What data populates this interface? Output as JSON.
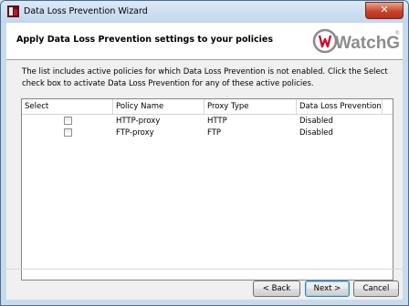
{
  "window": {
    "title": "Data Loss Prevention Wizard",
    "close_label": "✕"
  },
  "header": {
    "title": "Apply Data Loss Prevention settings to your policies",
    "logo_text": "WatchGuard",
    "logo_reg": "®"
  },
  "description": "The list includes active policies for which Data Loss Prevention is not enabled. Click the Select check box to activate Data Loss Prevention for any of these active policies.",
  "table": {
    "columns": [
      "Select",
      "Policy Name",
      "Proxy Type",
      "Data Loss Prevention"
    ],
    "rows": [
      {
        "selected": false,
        "policy": "HTTP-proxy",
        "type": "HTTP",
        "dlp": "Disabled"
      },
      {
        "selected": false,
        "policy": "FTP-proxy",
        "type": "FTP",
        "dlp": "Disabled"
      }
    ]
  },
  "buttons": {
    "back": "< Back",
    "next": "Next >",
    "cancel": "Cancel"
  },
  "colors": {
    "logo_gray": "#8c8c8c",
    "logo_red": "#c8102e",
    "close_red": "#c8442c"
  }
}
